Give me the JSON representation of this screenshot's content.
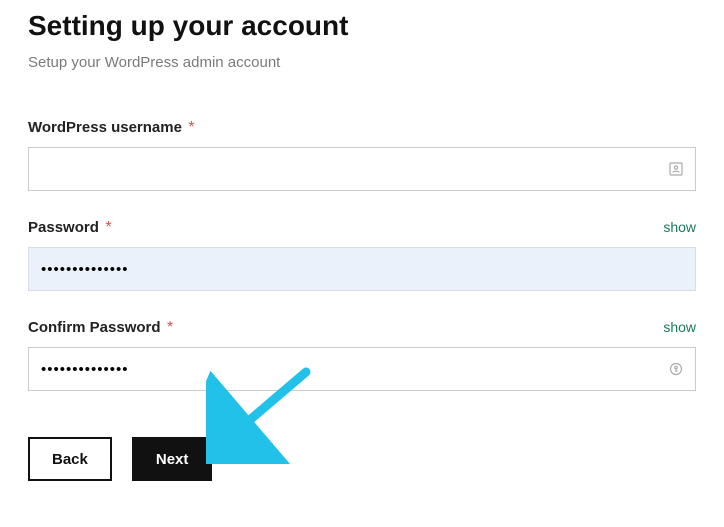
{
  "title": "Setting up your account",
  "subtitle": "Setup your WordPress admin account",
  "fields": {
    "username": {
      "label": "WordPress username",
      "required": "*",
      "value": ""
    },
    "password": {
      "label": "Password",
      "required": "*",
      "show": "show",
      "value": "••••••••••••••"
    },
    "confirm": {
      "label": "Confirm Password",
      "required": "*",
      "show": "show",
      "value": "••••••••••••••"
    }
  },
  "buttons": {
    "back": "Back",
    "next": "Next"
  },
  "colors": {
    "accent_link": "#1a7a5e",
    "required": "#d9534f",
    "arrow": "#22c1ea"
  }
}
